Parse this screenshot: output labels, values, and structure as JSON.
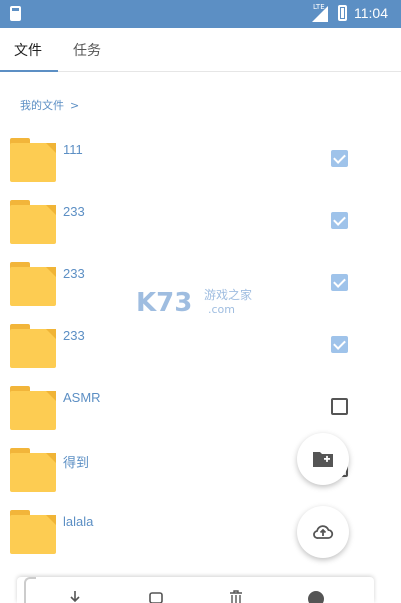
{
  "status_bar": {
    "network_label": "LTE",
    "time": "11:04"
  },
  "tabs": [
    {
      "label": "文件",
      "active": true
    },
    {
      "label": "任务",
      "active": false
    }
  ],
  "breadcrumb": {
    "label": "我的文件",
    "separator": ">"
  },
  "files": [
    {
      "name": "111",
      "checked": true
    },
    {
      "name": "233",
      "checked": true
    },
    {
      "name": "233",
      "checked": true
    },
    {
      "name": "233",
      "checked": true
    },
    {
      "name": "ASMR",
      "checked": false
    },
    {
      "name": "得到",
      "checked": false
    },
    {
      "name": "lalala",
      "checked": false
    }
  ],
  "fabs": {
    "new_folder_icon": "folder-add-icon",
    "upload_icon": "cloud-upload-icon"
  },
  "bottom_bar": {
    "icons": [
      "download-icon",
      "copy-icon",
      "delete-icon",
      "more-icon"
    ]
  },
  "watermark": {
    "logo_text": "K73",
    "site_text": "游戏之家",
    "domain_text": ".com"
  },
  "colors": {
    "accent": "#5c8fc4",
    "folder": "#fdcc52",
    "checked": "#9fc3ea"
  }
}
